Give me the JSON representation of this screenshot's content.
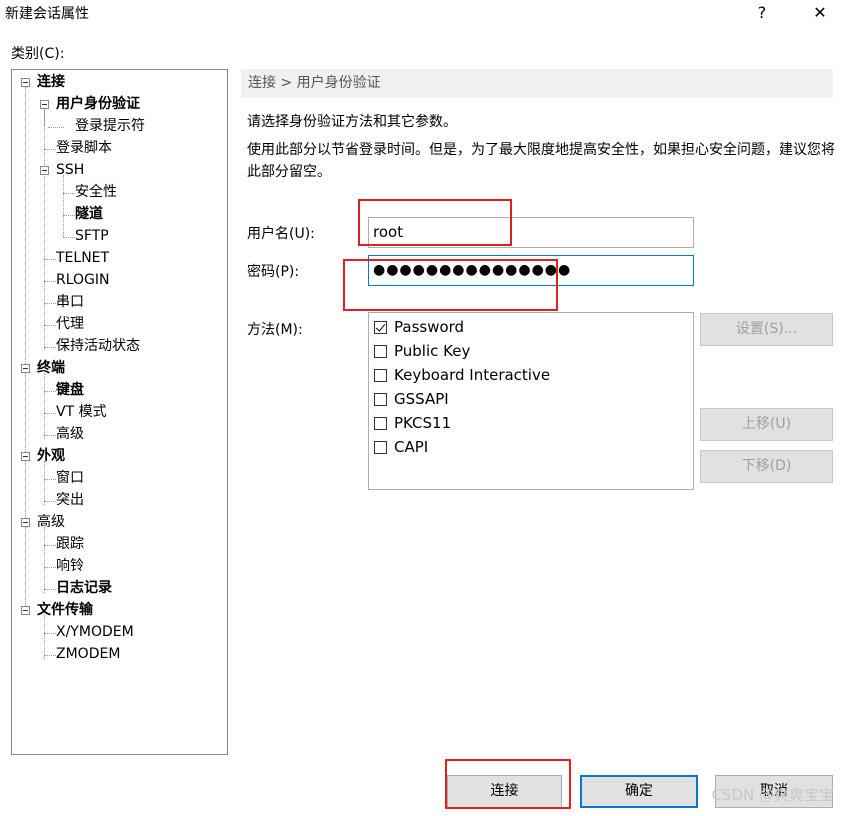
{
  "window": {
    "title": "新建会话属性",
    "help_label": "?",
    "close_label": "✕"
  },
  "category_label": "类别(C):",
  "tree": {
    "items": [
      {
        "label": "连接"
      },
      {
        "label": "用户身份验证"
      },
      {
        "label": "登录提示符"
      },
      {
        "label": "登录脚本"
      },
      {
        "label": "SSH"
      },
      {
        "label": "安全性"
      },
      {
        "label": "隧道"
      },
      {
        "label": "SFTP"
      },
      {
        "label": "TELNET"
      },
      {
        "label": "RLOGIN"
      },
      {
        "label": "串口"
      },
      {
        "label": "代理"
      },
      {
        "label": "保持活动状态"
      },
      {
        "label": "终端"
      },
      {
        "label": "键盘"
      },
      {
        "label": "VT 模式"
      },
      {
        "label": "高级"
      },
      {
        "label": "外观"
      },
      {
        "label": "窗口"
      },
      {
        "label": "突出"
      },
      {
        "label": "高级"
      },
      {
        "label": "跟踪"
      },
      {
        "label": "响铃"
      },
      {
        "label": "日志记录"
      },
      {
        "label": "文件传输"
      },
      {
        "label": "X/YMODEM"
      },
      {
        "label": "ZMODEM"
      }
    ]
  },
  "breadcrumb": "连接 > 用户身份验证",
  "description": {
    "line1": "请选择身份验证方法和其它参数。",
    "line2": "使用此部分以节省登录时间。但是，为了最大限度地提高安全性，如果担心安全问题，建议您将此部分留空。"
  },
  "form": {
    "username_label": "用户名(U):",
    "username_value": "root",
    "password_label": "密码(P):",
    "password_value": "●●●●●●●●●●●●●●●",
    "method_label": "方法(M):"
  },
  "methods": [
    {
      "label": "Password",
      "checked": true
    },
    {
      "label": "Public Key",
      "checked": false
    },
    {
      "label": "Keyboard Interactive",
      "checked": false
    },
    {
      "label": "GSSAPI",
      "checked": false
    },
    {
      "label": "PKCS11",
      "checked": false
    },
    {
      "label": "CAPI",
      "checked": false
    }
  ],
  "side_buttons": {
    "settings": "设置(S)...",
    "move_up": "上移(U)",
    "move_down": "下移(D)"
  },
  "dialog_buttons": {
    "connect": "连接",
    "ok": "确定",
    "cancel": "取消"
  },
  "watermark": "CSDN @爽爽宝宝",
  "colors": {
    "highlight": "#e02020",
    "focus": "#0078d7"
  }
}
